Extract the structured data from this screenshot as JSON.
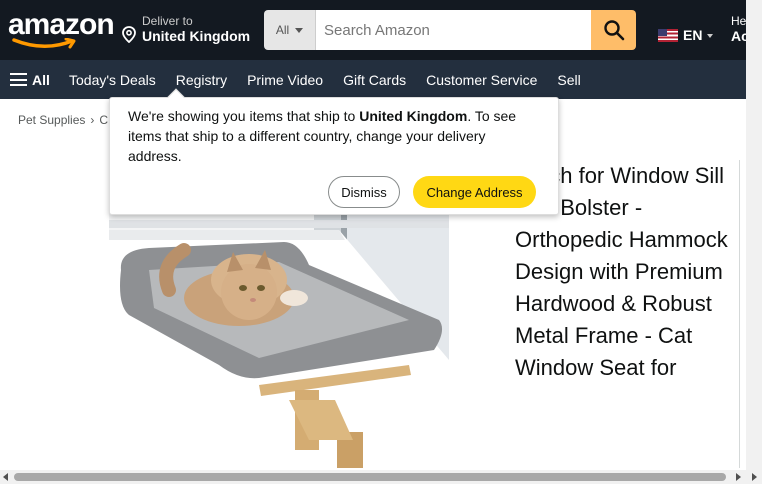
{
  "header": {
    "logo_text": "amazon",
    "deliver_line1": "Deliver to",
    "deliver_line2": "United Kingdom",
    "search_category": "All",
    "search_placeholder": "Search Amazon",
    "language": "EN",
    "account_line1": "Hello, sign in",
    "account_line2": "Account & Lists",
    "search_button_color": "#febd69",
    "background_color": "#131921"
  },
  "nav": {
    "all_label": "All",
    "links": [
      "Today's Deals",
      "Registry",
      "Prime Video",
      "Gift Cards",
      "Customer Service",
      "Sell"
    ],
    "background_color": "#232f3e"
  },
  "breadcrumb": {
    "first": "Pet Supplies",
    "separator": "›",
    "second": "C"
  },
  "popover": {
    "message_before": "We're showing you items that ship to ",
    "message_bold": "United Kingdom",
    "message_after": ". To see items that ship to a different country, change your delivery address.",
    "dismiss_label": "Dismiss",
    "change_label": "Change Address",
    "change_button_color": "#ffd814"
  },
  "product": {
    "title_visible": "Perch for Window Sill with Bolster - Orthopedic Hammock Design with Premium Hardwood & Robust Metal Frame - Cat Window Seat for",
    "image_name": "cat-window-perch-image"
  }
}
